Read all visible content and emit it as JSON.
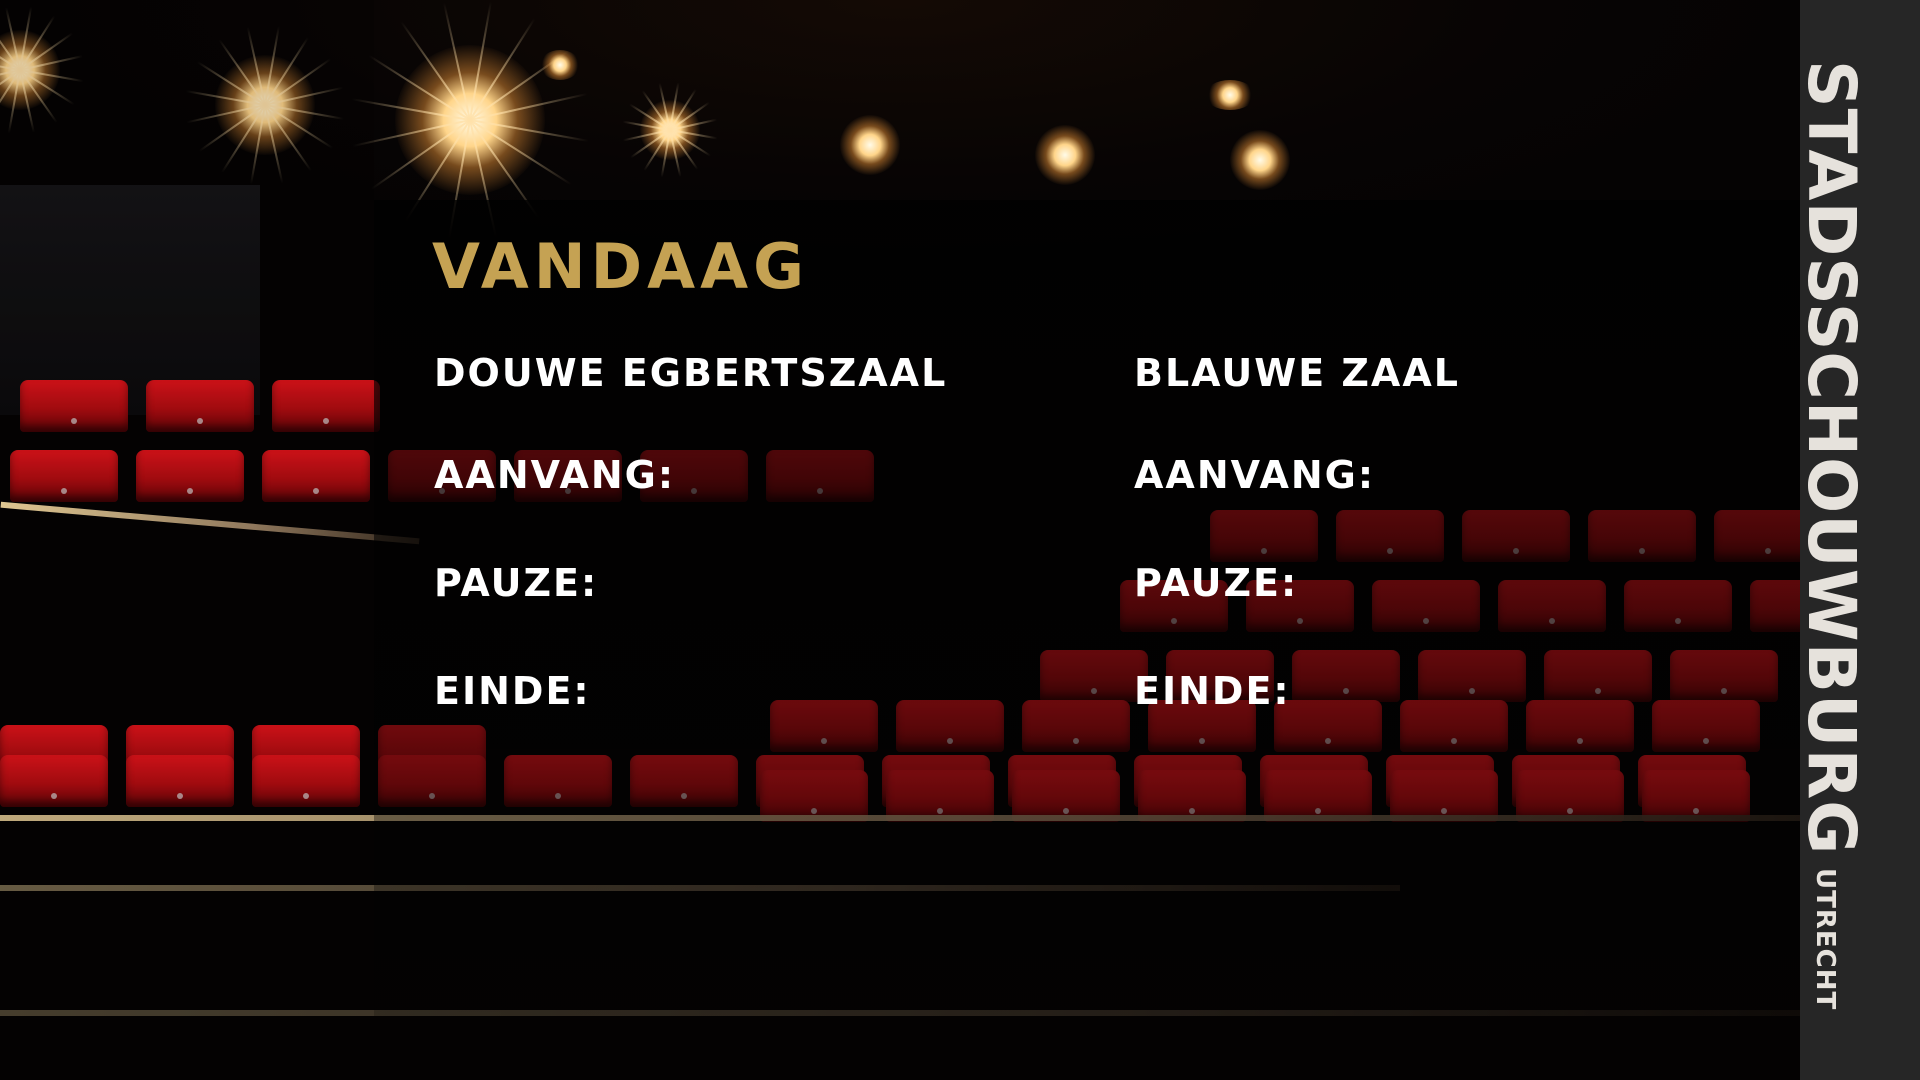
{
  "screen": {
    "title": "VANDAAG",
    "accent_color": "#c5a253",
    "halls": [
      {
        "name": "DOUWE EGBERTSZAAL",
        "fields": [
          {
            "label": "AANVANG:",
            "value": ""
          },
          {
            "label": "PAUZE:",
            "value": ""
          },
          {
            "label": "EINDE:",
            "value": ""
          }
        ]
      },
      {
        "name": "BLAUWE ZAAL",
        "fields": [
          {
            "label": "AANVANG:",
            "value": ""
          },
          {
            "label": "PAUZE:",
            "value": ""
          },
          {
            "label": "EINDE:",
            "value": ""
          }
        ]
      }
    ]
  },
  "logo": {
    "main_text": "STADSSCHOUWBURG",
    "sub_text": "UTRECHT",
    "strip_color": "#262626"
  },
  "background": {
    "subject": "theatre auditorium with red seats and spotlights"
  }
}
